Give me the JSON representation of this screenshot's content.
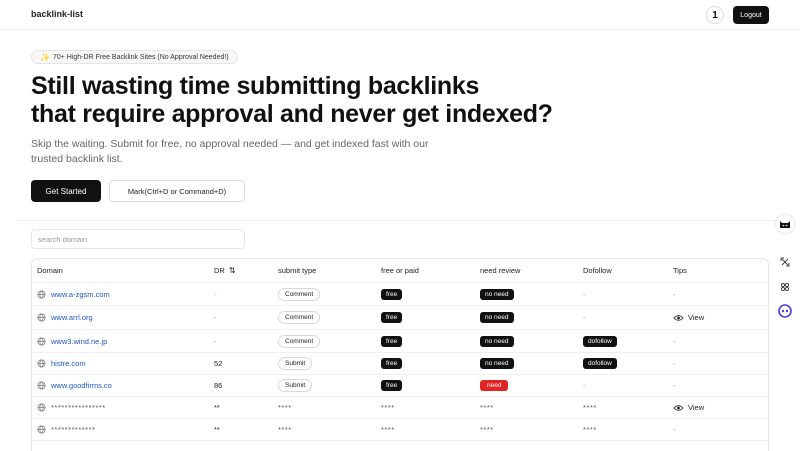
{
  "header": {
    "brand": "backlink-list",
    "avatar_letter": "1",
    "logout_label": "Logout"
  },
  "hero": {
    "badge": "70+ High-DR Free Backlink Sites (No Approval Needed!)",
    "headline_line1": "Still wasting time submitting backlinks",
    "headline_line2": "that require approval and never get indexed?",
    "subtitle_line1": "Skip the waiting. Submit for free, no approval needed — and get indexed fast with our",
    "subtitle_line2": "trusted backlink list.",
    "cta_primary": "Get Started",
    "cta_secondary": "Mark(Ctrl+D or Command+D)"
  },
  "search": {
    "placeholder": "search domain"
  },
  "table": {
    "columns": {
      "domain": "Domain",
      "dr": "DR",
      "submit_type": "submit type",
      "free_or_paid": "free or paid",
      "need_review": "need review",
      "dofollow": "Dofollow",
      "tips": "Tips"
    },
    "rows": [
      {
        "domain": "www.a-zgsm.com",
        "dr": "-",
        "type": "Comment",
        "paid": "free",
        "review": "no need",
        "review_alert": false,
        "dofollow": "-",
        "tips": "-"
      },
      {
        "domain": "www.arrl.org",
        "dr": "-",
        "type": "Comment",
        "paid": "free",
        "review": "no need",
        "review_alert": false,
        "dofollow": "-",
        "tips": "View"
      },
      {
        "domain": "www3.wind.ne.jp",
        "dr": "-",
        "type": "Comment",
        "paid": "free",
        "review": "no need",
        "review_alert": false,
        "dofollow": "dofollow",
        "tips": "-"
      },
      {
        "domain": "histre.com",
        "dr": "52",
        "type": "Submit",
        "paid": "free",
        "review": "no need",
        "review_alert": false,
        "dofollow": "dofollow",
        "tips": "-"
      },
      {
        "domain": "www.goodfirms.co",
        "dr": "86",
        "type": "Submit",
        "paid": "free",
        "review": "need",
        "review_alert": true,
        "dofollow": "-",
        "tips": "-"
      },
      {
        "domain": "****************",
        "dr": "**",
        "type": "****",
        "paid": "****",
        "review": "****",
        "review_alert": false,
        "dofollow": "****",
        "tips": "View"
      },
      {
        "domain": "*************",
        "dr": "**",
        "type": "****",
        "paid": "****",
        "review": "****",
        "review_alert": false,
        "dofollow": "****",
        "tips": "-"
      }
    ]
  },
  "colors": {
    "accent_dark": "#111111",
    "link_blue": "#2155c4",
    "alert_red": "#e02424"
  },
  "side_tools": [
    "cat-icon",
    "crop-icon",
    "link-icon",
    "robot-icon"
  ]
}
